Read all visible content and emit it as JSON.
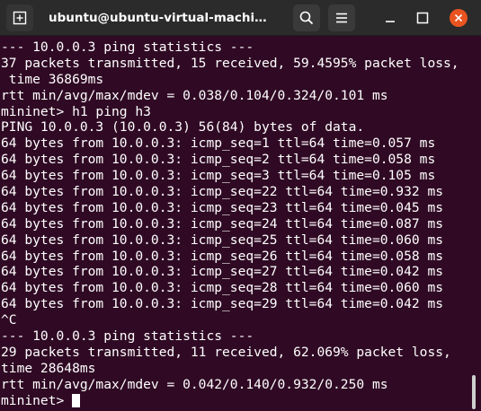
{
  "window": {
    "title": "ubuntu@ubuntu-virtual-machine: ~",
    "icons": {
      "new_tab": "new-tab-icon",
      "search": "search-icon",
      "menu": "hamburger-menu-icon",
      "minimize": "minimize-icon",
      "maximize": "maximize-icon",
      "close": "close-icon"
    },
    "close_color": "#e95420",
    "terminal_background": "#300a24"
  },
  "terminal": {
    "lines": [
      "--- 10.0.0.3 ping statistics ---",
      "37 packets transmitted, 15 received, 59.4595% packet loss,",
      " time 36869ms",
      "rtt min/avg/max/mdev = 0.038/0.104/0.324/0.101 ms",
      "mininet> h1 ping h3",
      "PING 10.0.0.3 (10.0.0.3) 56(84) bytes of data.",
      "64 bytes from 10.0.0.3: icmp_seq=1 ttl=64 time=0.057 ms",
      "64 bytes from 10.0.0.3: icmp_seq=2 ttl=64 time=0.058 ms",
      "64 bytes from 10.0.0.3: icmp_seq=3 ttl=64 time=0.105 ms",
      "64 bytes from 10.0.0.3: icmp_seq=22 ttl=64 time=0.932 ms",
      "64 bytes from 10.0.0.3: icmp_seq=23 ttl=64 time=0.045 ms",
      "64 bytes from 10.0.0.3: icmp_seq=24 ttl=64 time=0.087 ms",
      "64 bytes from 10.0.0.3: icmp_seq=25 ttl=64 time=0.060 ms",
      "64 bytes from 10.0.0.3: icmp_seq=26 ttl=64 time=0.058 ms",
      "64 bytes from 10.0.0.3: icmp_seq=27 ttl=64 time=0.042 ms",
      "64 bytes from 10.0.0.3: icmp_seq=28 ttl=64 time=0.060 ms",
      "64 bytes from 10.0.0.3: icmp_seq=29 ttl=64 time=0.042 ms",
      "^C",
      "--- 10.0.0.3 ping statistics ---",
      "29 packets transmitted, 11 received, 62.069% packet loss,",
      "time 28648ms",
      "rtt min/avg/max/mdev = 0.042/0.140/0.932/0.250 ms"
    ],
    "prompt": "mininet> "
  }
}
